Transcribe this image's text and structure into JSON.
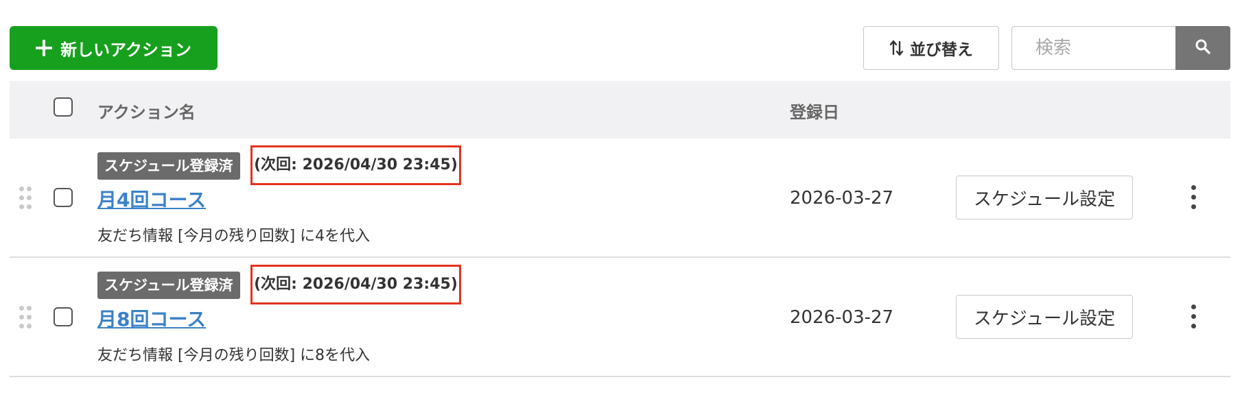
{
  "toolbar": {
    "new_action_label": "新しいアクション",
    "sort_label": "並び替え",
    "search_placeholder": "検索"
  },
  "table": {
    "headers": {
      "name": "アクション名",
      "date": "登録日"
    },
    "rows": [
      {
        "badge": "スケジュール登録済",
        "next_run": "(次回: 2026/04/30 23:45)",
        "name": "月4回コース",
        "description": "友だち情報 [今月の残り回数] に4を代入",
        "date": "2026-03-27",
        "schedule_button": "スケジュール設定"
      },
      {
        "badge": "スケジュール登録済",
        "next_run": "(次回: 2026/04/30 23:45)",
        "name": "月8回コース",
        "description": "友だち情報 [今月の残り回数] に8を代入",
        "date": "2026-03-27",
        "schedule_button": "スケジュール設定"
      }
    ]
  },
  "colors": {
    "primary_green": "#17a01e",
    "link_blue": "#3b82c8",
    "highlight_red": "#e4321e",
    "badge_gray": "#6b6b6b",
    "header_bg": "#f1f1f3"
  },
  "icons": {
    "new_action": "plus-icon",
    "sort": "sort-arrows-icon",
    "search": "search-icon",
    "drag": "drag-handle-icon",
    "more": "kebab-menu-icon"
  }
}
